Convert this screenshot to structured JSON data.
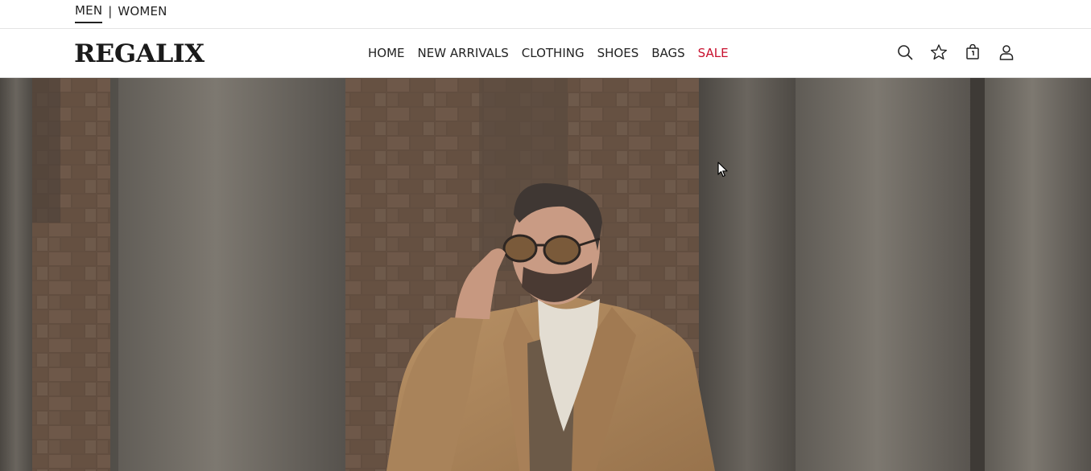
{
  "gender_tabs": {
    "men": "MEN",
    "separator": "|",
    "women": "WOMEN"
  },
  "brand": {
    "logo": "REGALIX"
  },
  "nav": {
    "items": [
      "HOME",
      "NEW ARRIVALS",
      "CLOTHING",
      "SHOES",
      "BAGS"
    ],
    "sale": "SALE"
  },
  "header_icons": [
    "search-icon",
    "star-icon",
    "shopping-bag-icon",
    "user-icon"
  ],
  "colors": {
    "sale": "#c8102e",
    "text": "#222222",
    "coat": "#b08a60",
    "brick": "#6e5848",
    "pillar": "#757068"
  },
  "hero": {
    "image": "man-in-camel-coat-sunglasses-between-stone-pillars"
  }
}
